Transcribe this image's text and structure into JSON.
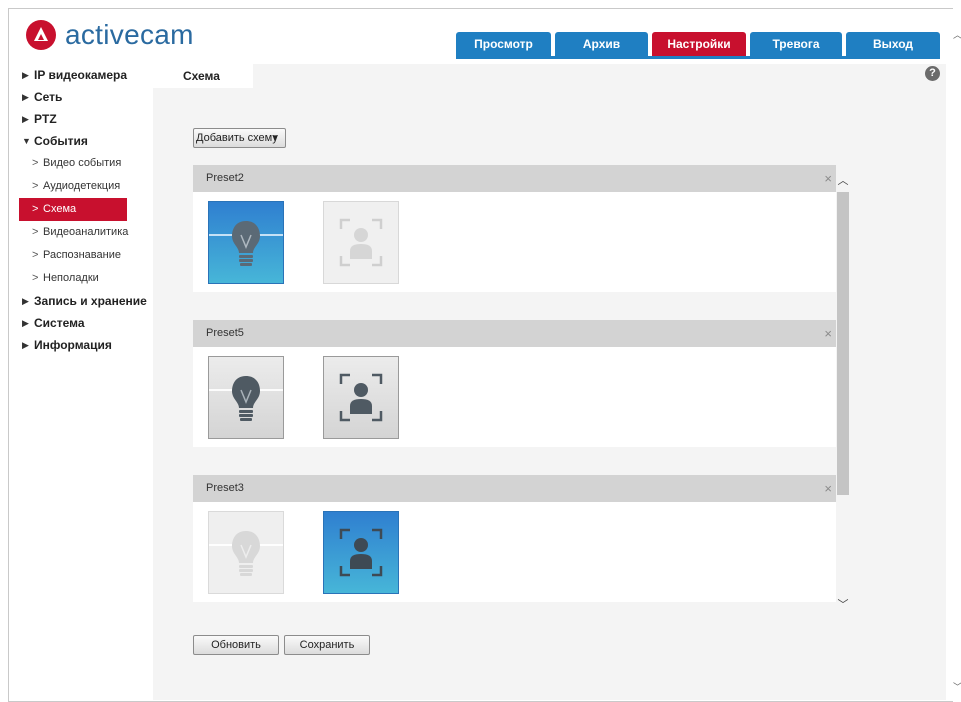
{
  "brand": {
    "name": "activecam",
    "accent": "#c8102e",
    "nav_blue": "#1f7fc2"
  },
  "topnav": {
    "tabs": [
      {
        "label": "Просмотр",
        "active": false
      },
      {
        "label": "Архив",
        "active": false
      },
      {
        "label": "Настройки",
        "active": true
      },
      {
        "label": "Тревога",
        "active": false
      },
      {
        "label": "Выход",
        "active": false
      }
    ]
  },
  "sidebar": {
    "items": [
      {
        "label": "IP видеокамера",
        "expanded": false
      },
      {
        "label": "Сеть",
        "expanded": false
      },
      {
        "label": "PTZ",
        "expanded": false
      },
      {
        "label": "События",
        "expanded": true
      },
      {
        "label": "Запись и хранение",
        "expanded": false
      },
      {
        "label": "Система",
        "expanded": false
      },
      {
        "label": "Информация",
        "expanded": false
      }
    ],
    "events_sub": [
      {
        "label": "Видео события",
        "active": false
      },
      {
        "label": "Аудиодетекция",
        "active": false
      },
      {
        "label": "Схема",
        "active": true
      },
      {
        "label": "Видеоаналитика",
        "active": false
      },
      {
        "label": "Распознавание",
        "active": false
      },
      {
        "label": "Неполадки",
        "active": false
      }
    ],
    "arrow_collapsed": "▶",
    "arrow_expanded": "▼",
    "sub_chevron": ">"
  },
  "main": {
    "tab_label": "Схема",
    "help_glyph": "?",
    "add_button": "Добавить схему",
    "add_caret": "▼",
    "close_glyph": "×",
    "presets": [
      {
        "name": "Preset2",
        "tile1": "bulb-active",
        "tile2": "person-disabled"
      },
      {
        "name": "Preset5",
        "tile1": "bulb-normal",
        "tile2": "person-normal"
      },
      {
        "name": "Preset3",
        "tile1": "bulb-disabled",
        "tile2": "person-active"
      }
    ],
    "scroll_up": "︿",
    "scroll_down": "﹀",
    "refresh_button": "Обновить",
    "save_button": "Сохранить"
  }
}
